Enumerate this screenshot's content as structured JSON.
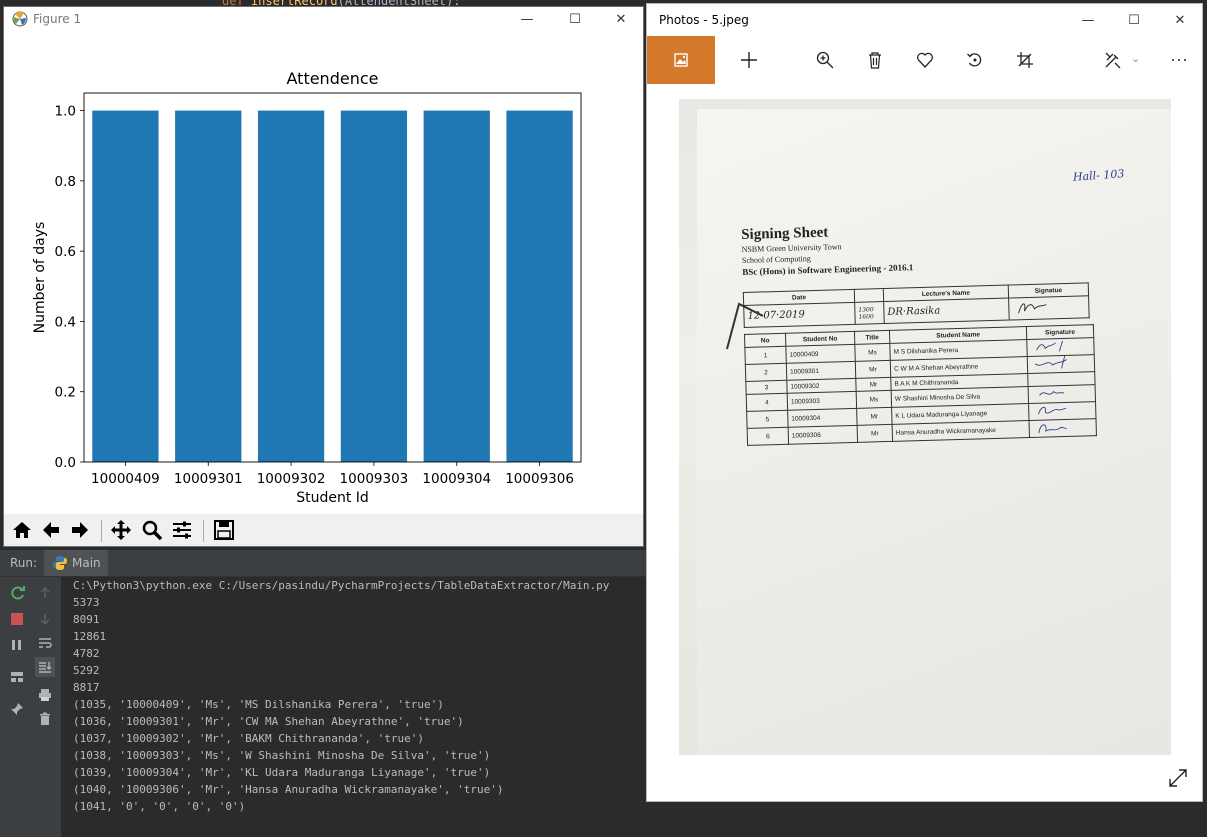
{
  "ide": {
    "code_snippet": "def insertRecord(AttendentSheet):"
  },
  "figure_window": {
    "title": "Figure 1",
    "controls": {
      "minimize": "—",
      "maximize": "☐",
      "close": "✕"
    },
    "chart_data": {
      "type": "bar",
      "title": "Attendence",
      "xlabel": "Student Id",
      "ylabel": "Number of days",
      "categories": [
        "10000409",
        "10009301",
        "10009302",
        "10009303",
        "10009304",
        "10009306"
      ],
      "values": [
        1.0,
        1.0,
        1.0,
        1.0,
        1.0,
        1.0
      ],
      "ylim": [
        0,
        1.05
      ],
      "yticks": [
        "0.0",
        "0.2",
        "0.4",
        "0.6",
        "0.8",
        "1.0"
      ],
      "bar_color": "#1f77b4",
      "grid": false
    },
    "toolbar": [
      "home-icon",
      "back-arrow-icon",
      "forward-arrow-icon",
      "pan-icon",
      "zoom-icon",
      "configure-subplots-icon",
      "save-icon"
    ]
  },
  "run_panel": {
    "run_label": "Run:",
    "tab_label": "Main",
    "console_lines": [
      "C:\\Python3\\python.exe C:/Users/pasindu/PycharmProjects/TableDataExtractor/Main.py",
      "5373",
      "8091",
      "12861",
      "4782",
      "5292",
      "8817",
      "(1035, '10000409', 'Ms', 'MS Dilshanika Perera', 'true')",
      "(1036, '10009301', 'Mr', 'CW MA Shehan Abeyrathne', 'true')",
      "(1037, '10009302', 'Mr', 'BAKM Chithrananda', 'true')",
      "(1038, '10009303', 'Ms', 'W Shashini Minosha De Silva', 'true')",
      "(1039, '10009304', 'Mr', 'KL Udara Maduranga Liyanage', 'true')",
      "(1040, '10009306', 'Mr', 'Hansa Anuradha Wickramanayake', 'true')",
      "(1041, '0', '0', '0', '0')"
    ]
  },
  "photos_window": {
    "title": "Photos - 5.jpeg",
    "controls": {
      "minimize": "—",
      "maximize": "☐",
      "close": "✕"
    },
    "accent_color": "#d4782a",
    "document": {
      "hall_note": "Hall- 103",
      "heading": "Signing Sheet",
      "org": "NSBM Green University Town",
      "school": "School of Computing",
      "program": "BSc (Hons) in Software Engineering - 2016.1",
      "session_headers": [
        "Date",
        "",
        "Lecture's Name",
        "Signatue"
      ],
      "session_row": {
        "date": "12·07·2019",
        "time_from": "1300",
        "time_to": "1600",
        "lecturer": "DR·Rasika"
      },
      "student_headers": [
        "No",
        "Student No",
        "Title",
        "Student Name",
        "Signature"
      ],
      "students": [
        {
          "no": "1",
          "id": "10000409",
          "title": "Ms",
          "name": "M S Dilshanika  Perera"
        },
        {
          "no": "2",
          "id": "10009301",
          "title": "Mr",
          "name": "C W M  A Shehan  Abeyrathne"
        },
        {
          "no": "3",
          "id": "10009302",
          "title": "Mr",
          "name": "B A K M  Chithrananda"
        },
        {
          "no": "4",
          "id": "10009303",
          "title": "Ms",
          "name": "W Shashini Minosha  De Silva"
        },
        {
          "no": "5",
          "id": "10009304",
          "title": "Mr",
          "name": "K L Udara Maduranga  Liyanage"
        },
        {
          "no": "6",
          "id": "10009306",
          "title": "Mr",
          "name": "Hansa Anuradha  Wickramanayake"
        }
      ]
    }
  }
}
